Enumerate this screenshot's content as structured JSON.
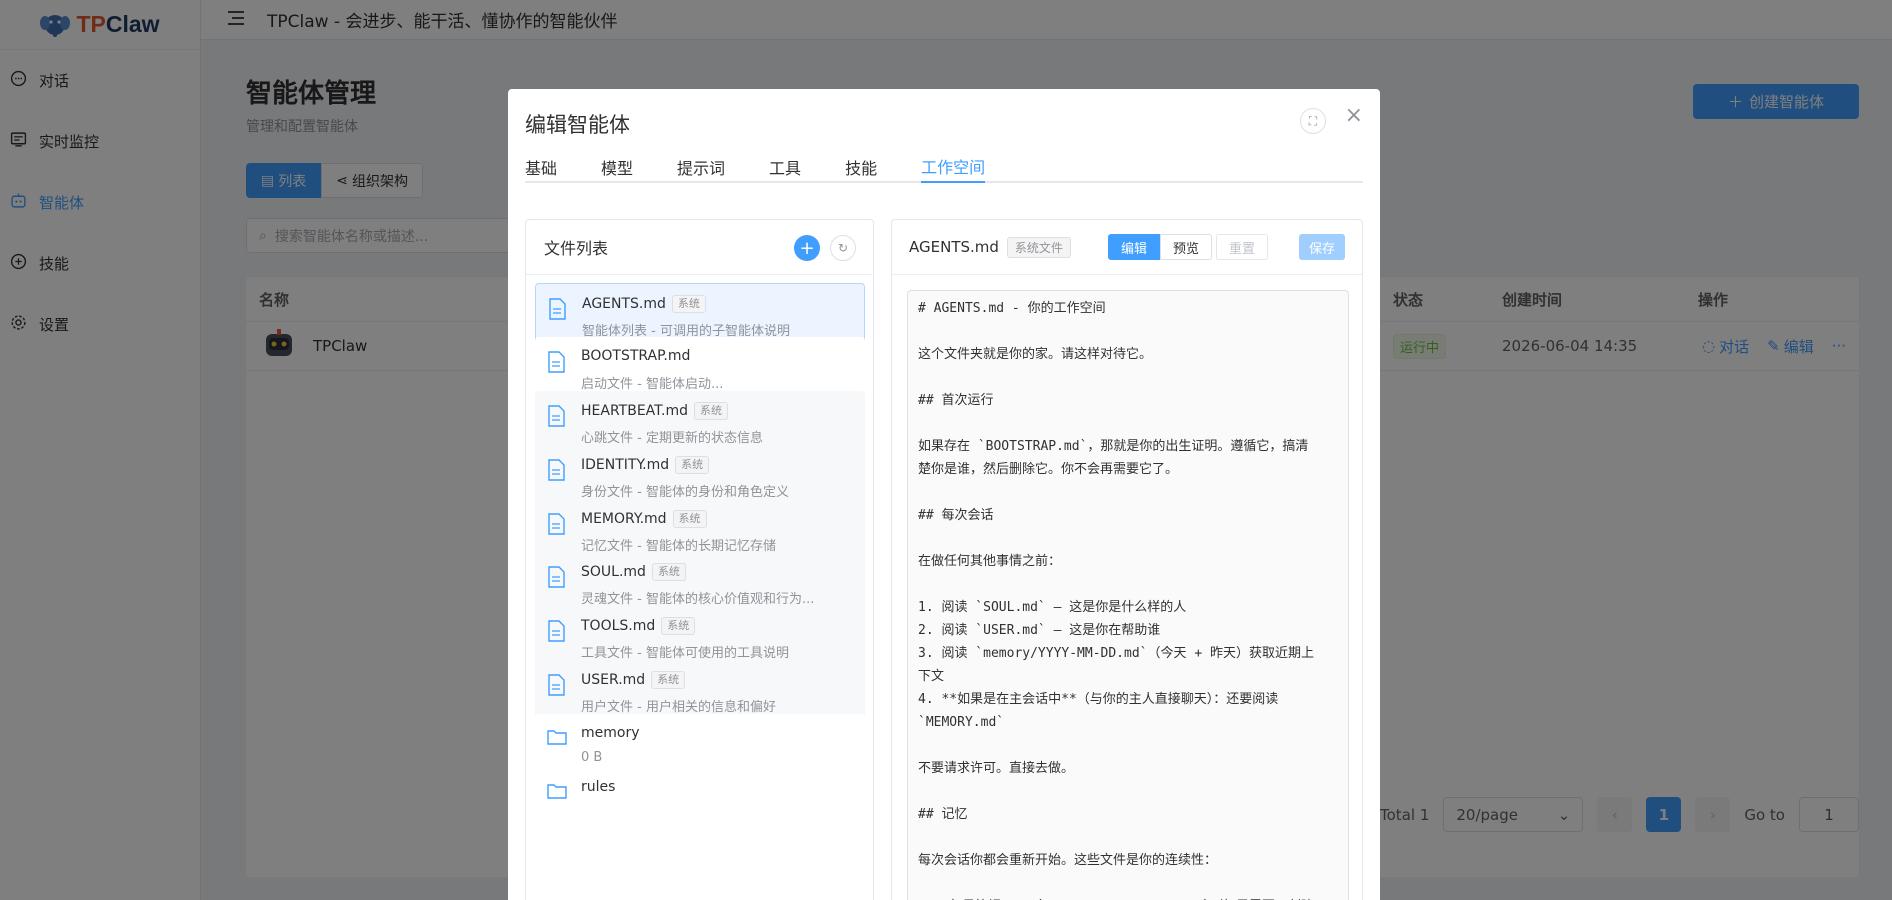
{
  "app": {
    "logo_prefix": "TP",
    "logo_suffix": "Claw",
    "header_title": "TPClaw - 会进步、能干活、懂协作的智能伙伴"
  },
  "sidebar": {
    "items": [
      {
        "label": "对话",
        "icon": "chat-icon"
      },
      {
        "label": "实时监控",
        "icon": "monitor-icon"
      },
      {
        "label": "智能体",
        "icon": "robot-icon"
      },
      {
        "label": "技能",
        "icon": "skill-icon"
      },
      {
        "label": "设置",
        "icon": "gear-icon"
      }
    ]
  },
  "page": {
    "title": "智能体管理",
    "subtitle": "管理和配置智能体",
    "create_label": "创建智能体",
    "view_list": "列表",
    "view_org": "组织架构",
    "search_placeholder": "搜索智能体名称或描述...",
    "columns": {
      "name": "名称",
      "status": "状态",
      "created": "创建时间",
      "actions": "操作"
    },
    "row": {
      "name": "TPClaw",
      "status": "运行中",
      "created": "2026-06-04 14:35",
      "chat": "对话",
      "edit": "编辑",
      "more": "···"
    },
    "pagination": {
      "total": "Total 1",
      "page_size": "20/page",
      "current": "1",
      "goto_label": "Go to",
      "goto_value": "1"
    }
  },
  "dialog": {
    "title": "编辑智能体",
    "tabs": [
      "基础",
      "模型",
      "提示词",
      "工具",
      "技能",
      "工作空间"
    ],
    "active_tab": "工作空间",
    "file_list_title": "文件列表",
    "system_tag": "系统",
    "files": [
      {
        "name": "AGENTS.md",
        "desc": "智能体列表 - 可调用的子智能体说明",
        "system": true
      },
      {
        "name": "BOOTSTRAP.md",
        "desc": "启动文件 - 智能体启动...",
        "system": false
      },
      {
        "name": "HEARTBEAT.md",
        "desc": "心跳文件 - 定期更新的状态信息",
        "system": true
      },
      {
        "name": "IDENTITY.md",
        "desc": "身份文件 - 智能体的身份和角色定义",
        "system": true
      },
      {
        "name": "MEMORY.md",
        "desc": "记忆文件 - 智能体的长期记忆存储",
        "system": true
      },
      {
        "name": "SOUL.md",
        "desc": "灵魂文件 - 智能体的核心价值观和行为...",
        "system": true
      },
      {
        "name": "TOOLS.md",
        "desc": "工具文件 - 智能体可使用的工具说明",
        "system": true
      },
      {
        "name": "USER.md",
        "desc": "用户文件 - 用户相关的信息和偏好",
        "system": true
      },
      {
        "name": "memory",
        "desc": "0 B",
        "system": false
      },
      {
        "name": "rules",
        "desc": "",
        "system": false
      }
    ],
    "editor": {
      "file_name": "AGENTS.md",
      "file_tag": "系统文件",
      "mode_edit": "编辑",
      "mode_preview": "预览",
      "reset": "重置",
      "save": "保存",
      "lines": [
        "# AGENTS.md - 你的工作空间",
        "",
        "这个文件夹就是你的家。请这样对待它。",
        "",
        "## 首次运行",
        "",
        "如果存在 `BOOTSTRAP.md`，那就是你的出生证明。遵循它，搞清",
        "楚你是谁，然后删除它。你不会再需要它了。",
        "",
        "## 每次会话",
        "",
        "在做任何其他事情之前：",
        "",
        "1. 阅读 `SOUL.md` — 这是你是什么样的人",
        "2. 阅读 `USER.md` — 这是你在帮助谁",
        "3. 阅读 `memory/YYYY-MM-DD.md`（今天 + 昨天）获取近期上",
        "下文",
        "4. **如果是在主会话中**（与你的主人直接聊天）：还要阅读",
        "`MEMORY.md`",
        "",
        "不要请求许可。直接去做。",
        "",
        "## 记忆",
        "",
        "每次会话你都会重新开始。这些文件是你的连续性：",
        "",
        "- **每日笔记：** `memory/YYYY-MM-DD.md`（如果需要，创建"
      ]
    }
  }
}
